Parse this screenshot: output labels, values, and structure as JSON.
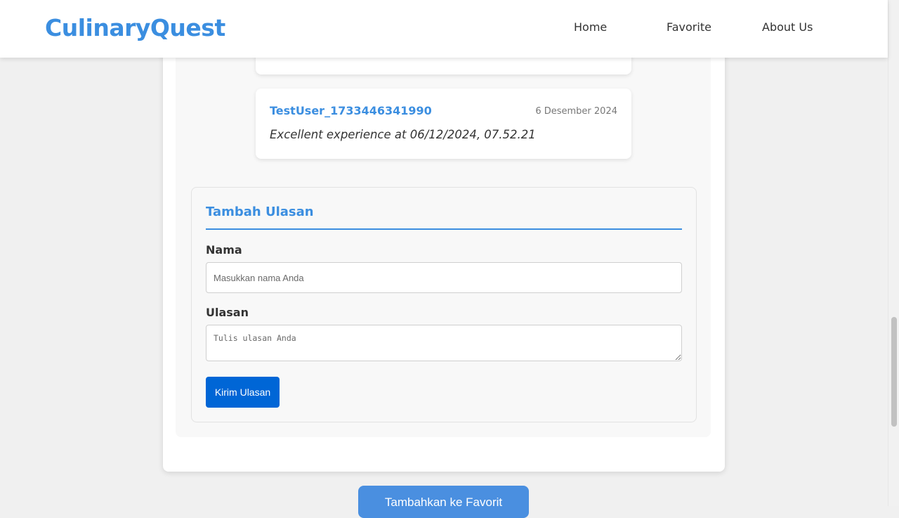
{
  "brand": {
    "name": "CulinaryQuest",
    "color": "#3b8ee0"
  },
  "nav": {
    "items": [
      {
        "label": "Home"
      },
      {
        "label": "Favorite"
      },
      {
        "label": "About Us"
      }
    ]
  },
  "reviews": {
    "items": [
      {
        "author": "TestUser_1733446341990",
        "date": "6 Desember 2024",
        "text": "Excellent experience at 06/12/2024, 07.52.21"
      }
    ]
  },
  "review_form": {
    "title": "Tambah Ulasan",
    "name_label": "Nama",
    "name_placeholder": "Masukkan nama Anda",
    "review_label": "Ulasan",
    "review_placeholder": "Tulis ulasan Anda",
    "submit_label": "Kirim Ulasan"
  },
  "favorite_button": {
    "label": "Tambahkan ke Favorit"
  }
}
